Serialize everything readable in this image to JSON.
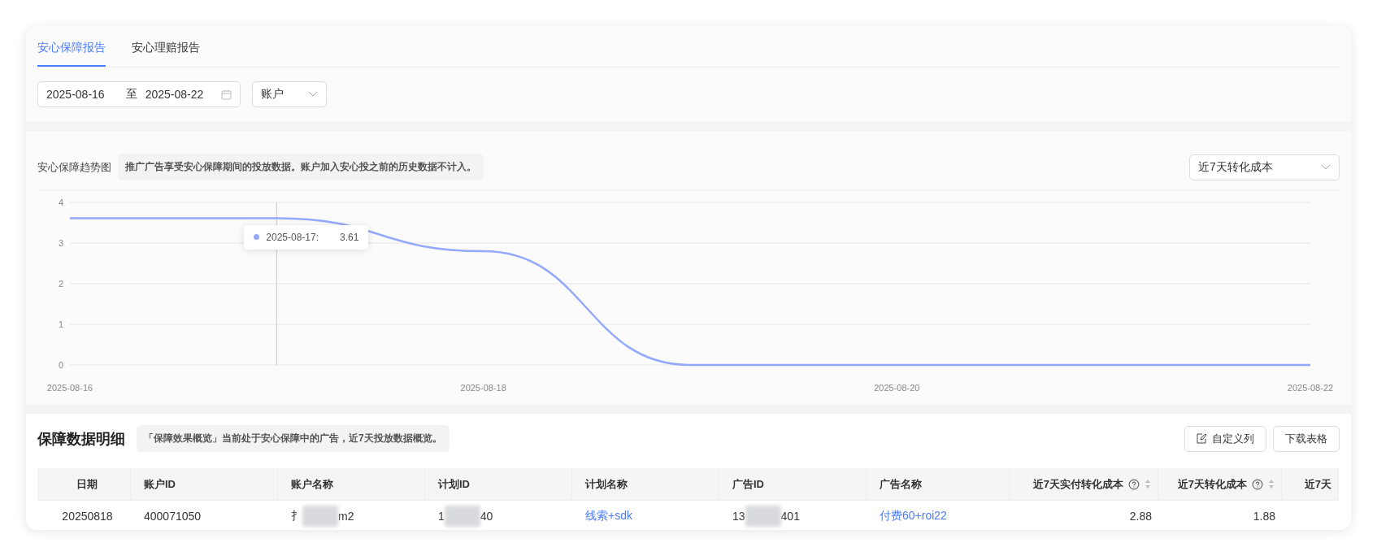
{
  "tabs": [
    {
      "label": "安心保障报告",
      "selected": true
    },
    {
      "label": "安心理赔报告",
      "selected": false
    }
  ],
  "filters": {
    "date_start": "2025-08-16",
    "date_separator": "至",
    "date_end": "2025-08-22",
    "account_select": "账户"
  },
  "trend": {
    "tooltip": {
      "label": "2025-08-17:",
      "value": "3.61"
    },
    "title": "安心保障趋势图",
    "note": "推广广告享受安心保障期间的投放数据。账户加入安心投之前的历史数据不计入。",
    "metric_select": "近7天转化成本",
    "chart_data": {
      "type": "line",
      "x": [
        "2025-08-16",
        "2025-08-17",
        "2025-08-18",
        "2025-08-19",
        "2025-08-20",
        "2025-08-21",
        "2025-08-22"
      ],
      "series": [
        {
          "color": "#94a9fb",
          "values": [
            3.61,
            3.61,
            2.8,
            0,
            0,
            0,
            0
          ]
        }
      ],
      "xlim": [
        "2025-08-16",
        "2025-08-22"
      ],
      "ylim": [
        0,
        4
      ],
      "grid": true,
      "ref_lines": [
        {
          "axis": "x",
          "value": "2025-08-17",
          "color": "#cccccc"
        }
      ],
      "yticks": [
        0,
        1,
        2,
        3,
        4
      ],
      "xticks": [
        "2025-08-16",
        "2025-08-18",
        "2025-08-20",
        "2025-08-22"
      ]
    }
  },
  "details": {
    "title": "保障数据明细",
    "note": "「保障效果概览」当前处于安心保障中的广告，近7天投放数据概览。",
    "buttons": [
      {
        "label": "自定义列",
        "kind": "edit"
      },
      {
        "label": "下载表格",
        "kind": "plain"
      }
    ],
    "columns": [
      {
        "label": "日期",
        "kind": "date",
        "help": false
      },
      {
        "label": "账户ID",
        "kind": "text",
        "help": false
      },
      {
        "label": "账户名称",
        "kind": "text",
        "help": false
      },
      {
        "label": "计划ID",
        "kind": "text",
        "help": false
      },
      {
        "label": "计划名称",
        "kind": "text",
        "help": false
      },
      {
        "label": "广告ID",
        "kind": "text",
        "help": false
      },
      {
        "label": "广告名称",
        "kind": "text",
        "help": false
      },
      {
        "label": "近7天实付转化成本",
        "kind": "metric",
        "help": true
      },
      {
        "label": "近7天转化成本",
        "kind": "metric",
        "help": true
      },
      {
        "label": "近7天",
        "kind": "metric",
        "help": false
      }
    ],
    "rows": [
      [
        {
          "kind": "text",
          "text": "20250818"
        },
        {
          "kind": "text",
          "text": "400071050"
        },
        {
          "kind": "redacted",
          "head": "扌",
          "tail": "m2"
        },
        {
          "kind": "redacted",
          "head": "1",
          "tail": "40"
        },
        {
          "kind": "link",
          "text": "线索+sdk"
        },
        {
          "kind": "redacted",
          "head": "13",
          "tail": "401"
        },
        {
          "kind": "link",
          "text": "付费60+roi22"
        },
        {
          "kind": "text",
          "text": "2.88"
        },
        {
          "kind": "text",
          "text": "1.88"
        },
        {
          "kind": "empty"
        }
      ]
    ]
  }
}
